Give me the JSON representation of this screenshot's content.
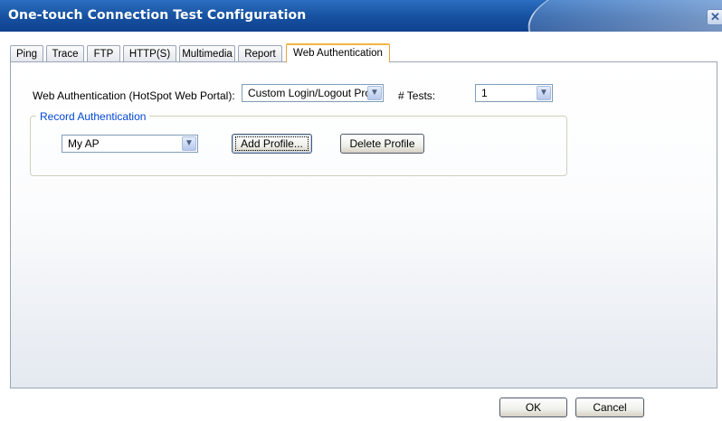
{
  "window": {
    "title": "One-touch Connection Test Configuration",
    "close_glyph": "✕"
  },
  "tabs": [
    {
      "label": "Ping"
    },
    {
      "label": "Trace"
    },
    {
      "label": "FTP"
    },
    {
      "label": "HTTP(S)"
    },
    {
      "label": "Multimedia"
    },
    {
      "label": "Report"
    },
    {
      "label": "Web Authentication",
      "active": true
    }
  ],
  "web_auth": {
    "portal_label": "Web Authentication (HotSpot Web Portal):",
    "portal_value": "Custom Login/Logout Profi",
    "tests_label": "# Tests:",
    "tests_value": "1"
  },
  "record_auth": {
    "group_label": "Record Authentication",
    "profile_value": "My AP",
    "add_profile_label": "Add Profile...",
    "delete_profile_label": "Delete Profile"
  },
  "footer": {
    "ok_label": "OK",
    "cancel_label": "Cancel"
  },
  "icons": {
    "dropdown": "chevron-down-icon",
    "close": "close-icon"
  }
}
